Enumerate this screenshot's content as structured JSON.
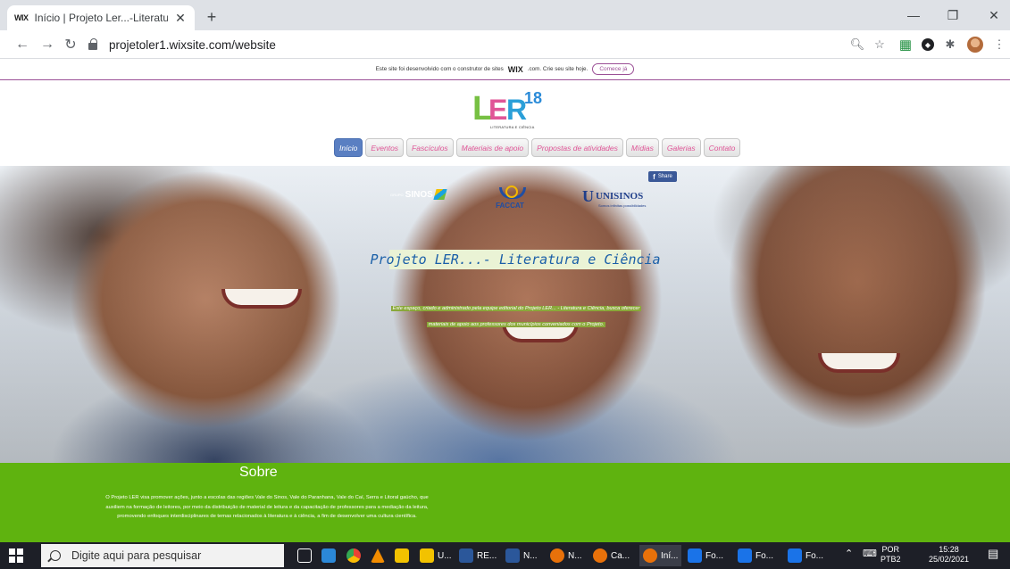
{
  "browser": {
    "tab_title": "Início | Projeto Ler...-Literatura e",
    "tab_favicon": "WIX",
    "url": "projetoler1.wixsite.com/website"
  },
  "wix_banner": {
    "text": "Este site foi desenvolvido com o construtor de sites",
    "logo": "WIX",
    "suffix": ".com. Crie seu site hoje.",
    "button": "Comece já"
  },
  "site": {
    "logo_text": {
      "l": "L",
      "e": "E",
      "r": "R",
      "superscript": "18",
      "tagline": "LITERATURA E CIÊNCIA"
    },
    "menu": [
      {
        "label": "Início",
        "active": true
      },
      {
        "label": "Eventos",
        "active": false
      },
      {
        "label": "Fascículos",
        "active": false
      },
      {
        "label": "Materiais de apoio",
        "active": false
      },
      {
        "label": "Propostas de atividades",
        "active": false
      },
      {
        "label": "Mídias",
        "active": false
      },
      {
        "label": "Galerias",
        "active": false
      },
      {
        "label": "Contato",
        "active": false
      }
    ]
  },
  "hero": {
    "share_label": "Share",
    "sponsors": {
      "sinos_label": "GRUPO",
      "sinos_name": "SINOS",
      "faccat_name": "FACCAT",
      "unisinos_name": "UNISINOS",
      "unisinos_tagline": "Somos infinitas possibilidades"
    },
    "title": "Projeto LER...- Literatura e Ciência",
    "description_line1": "Este espaço, criado e administrado pela equipe editorial do Projeto LER... - Literatura e Ciência, busca oferecer",
    "description_line2": "materiais de apoio aos professores dos municípios conveniados com o Projeto."
  },
  "sobre": {
    "title": "Sobre",
    "text": "O Projeto LER visa promover ações, junto a escolas das regiões Vale do Sinos, Vale do Paranhana, Vale do Caí, Serra e Litoral gaúcho, que auxiliem na formação de leitores, por meio da distribuição de material de leitura e da capacitação de professores para a mediação da leitura, promovendo enfoques interdisciplinares de temas relacionados à literatura e à ciência, a fim de desenvolver uma cultura científica."
  },
  "taskbar": {
    "search_placeholder": "Digite aqui para pesquisar",
    "apps": [
      {
        "label": "U...",
        "color": "#f2c200"
      },
      {
        "label": "RE...",
        "color": "#2b579a"
      },
      {
        "label": "N...",
        "color": "#2b579a"
      },
      {
        "label": "N...",
        "color": "#e8710a"
      },
      {
        "label": "Ca...",
        "color": "#e8710a"
      },
      {
        "label": "Iní...",
        "color": "#e8710a"
      },
      {
        "label": "Fo...",
        "color": "#1a73e8"
      },
      {
        "label": "Fo...",
        "color": "#1a73e8"
      },
      {
        "label": "Fo...",
        "color": "#1a73e8"
      }
    ],
    "language": "POR",
    "layout": "PTB2",
    "time": "15:28",
    "date": "25/02/2021"
  }
}
